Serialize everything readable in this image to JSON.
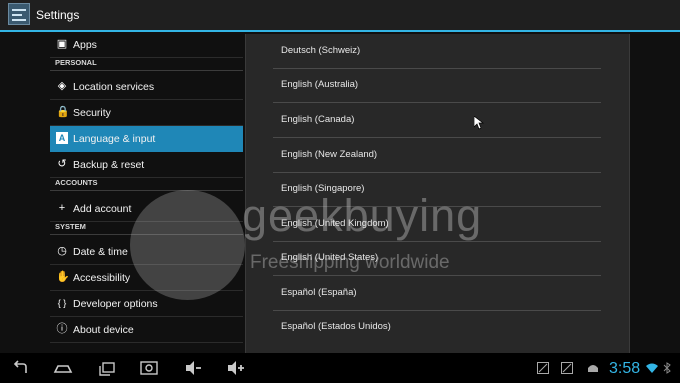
{
  "title_bar": {
    "title": "Settings"
  },
  "sidebar": {
    "items": [
      {
        "label": "Apps",
        "icon": "apps-icon"
      },
      {
        "section": "PERSONAL"
      },
      {
        "label": "Location services",
        "icon": "location-icon"
      },
      {
        "label": "Security",
        "icon": "lock-icon"
      },
      {
        "label": "Language & input",
        "icon": "language-icon",
        "selected": true
      },
      {
        "label": "Backup & reset",
        "icon": "backup-icon"
      },
      {
        "section": "ACCOUNTS"
      },
      {
        "label": "Add account",
        "icon": "plus-icon"
      },
      {
        "section": "SYSTEM"
      },
      {
        "label": "Date & time",
        "icon": "clock-icon"
      },
      {
        "label": "Accessibility",
        "icon": "hand-icon"
      },
      {
        "label": "Developer options",
        "icon": "braces-icon"
      },
      {
        "label": "About device",
        "icon": "info-icon"
      }
    ]
  },
  "language_dialog": {
    "options": [
      "Deutsch (Schweiz)",
      "English (Australia)",
      "English (Canada)",
      "English (New Zealand)",
      "English (Singapore)",
      "English (United Kingdom)",
      "English (United States)",
      "Español (España)",
      "Español (Estados Unidos)"
    ]
  },
  "watermark": {
    "brand": "geekbuying",
    "tagline": "Freeshipping worldwide"
  },
  "navbar": {
    "buttons": [
      "back-icon",
      "home-icon",
      "recent-apps-icon",
      "screenshot-icon",
      "volume-down-icon",
      "volume-up-icon"
    ],
    "status": {
      "time": "3:58",
      "icons": [
        "notification-icon",
        "notification-icon-2",
        "android-debug-icon",
        "wifi-icon",
        "bluetooth-icon"
      ]
    },
    "accent": "#33b5e5"
  }
}
